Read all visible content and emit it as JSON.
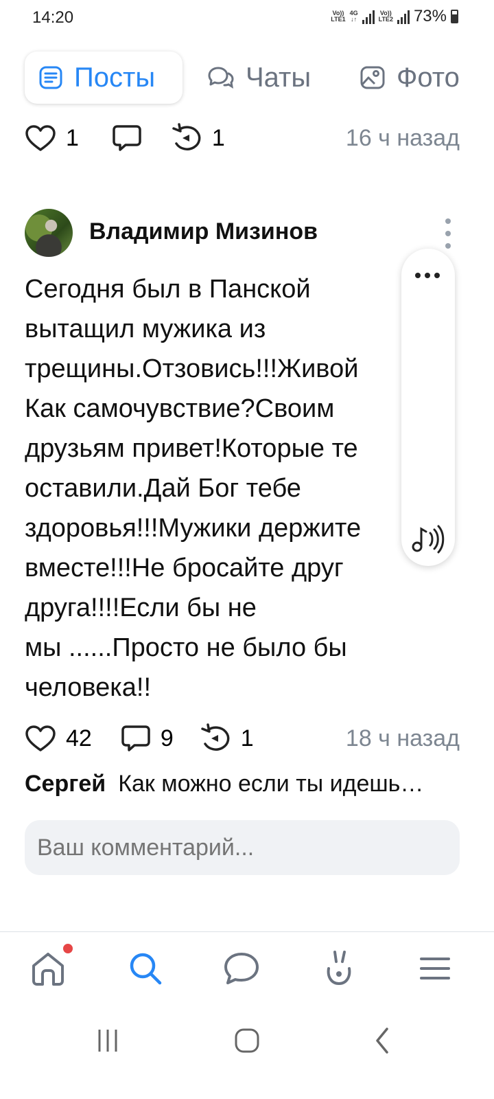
{
  "status_bar": {
    "time": "14:20",
    "sim1_top": "Vo))",
    "sim1_bottom": "LTE1",
    "network": "4G",
    "sim2_top": "Vo))",
    "sim2_bottom": "LTE2",
    "battery": "73%"
  },
  "tabs": [
    {
      "label": "Посты",
      "icon": "posts-icon",
      "active": true
    },
    {
      "label": "Чаты",
      "icon": "chats-icon",
      "active": false
    },
    {
      "label": "Фото",
      "icon": "photo-icon",
      "active": false
    }
  ],
  "prev_post": {
    "likes": "1",
    "comments": "",
    "reposts": "1",
    "time": "16 ч назад"
  },
  "post": {
    "author": "Владимир Мизинов",
    "text": "Сегодня был в Панской\nвытащил мужика из\nтрещины.Отзовись!!!Живой\nКак самочувствие?Своим\nдрузьям привет!Которые те\nоставили.Дай Бог тебе\nздоровья!!!Мужики держите\nвместе!!!Не бросайте друг\nдруга!!!!Если бы не\nмы ......Просто не было бы\nчеловека!!",
    "likes": "42",
    "comments": "9",
    "reposts": "1",
    "time": "18 ч назад"
  },
  "comment": {
    "author": "Сергей",
    "text": "Как можно если ты идешь…"
  },
  "comment_input": {
    "placeholder": "Ваш комментарий..."
  },
  "floating_panel": {
    "icons": [
      "more-icon",
      "audio-icon"
    ]
  },
  "bottom_nav": {
    "items": [
      "home-icon",
      "search-icon",
      "messages-icon",
      "clips-icon",
      "menu-icon"
    ],
    "accent": "#2787f5",
    "badge_color": "#e64646"
  },
  "system_nav": [
    "recent-apps-icon",
    "home-button-icon",
    "back-icon"
  ]
}
